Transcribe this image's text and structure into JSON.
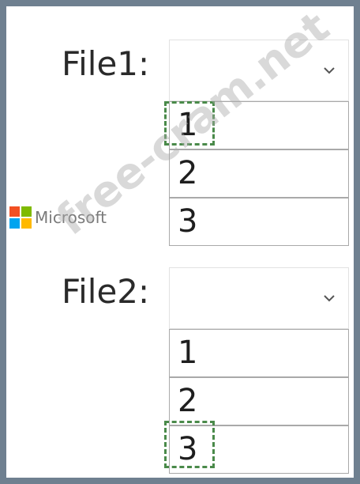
{
  "file1": {
    "label": "File1:",
    "options": [
      "1",
      "2",
      "3"
    ],
    "selected": "1"
  },
  "file2": {
    "label": "File2:",
    "options": [
      "1",
      "2",
      "3"
    ],
    "selected": "3"
  },
  "watermark": "free-cram.net",
  "logo": {
    "text": "Microsoft",
    "colors": [
      "#f25022",
      "#7fba00",
      "#00a4ef",
      "#ffb900"
    ]
  }
}
